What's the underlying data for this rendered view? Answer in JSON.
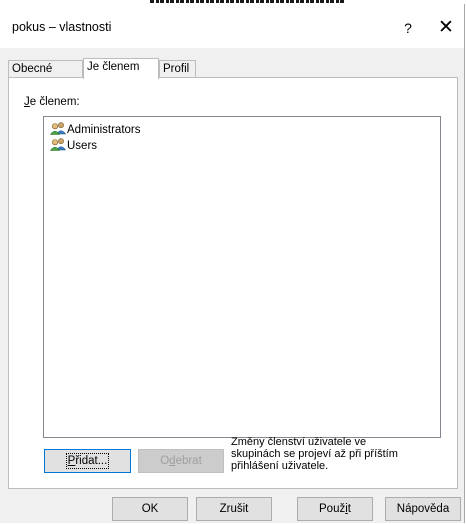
{
  "window": {
    "title": "pokus – vlastnosti",
    "help_glyph": "?",
    "close_glyph": "✕"
  },
  "tabs": [
    {
      "label": "Obecné",
      "active": false
    },
    {
      "label": "Je členem",
      "active": true
    },
    {
      "label": "Profil",
      "active": false
    }
  ],
  "member_of": {
    "label_mnemonic": "J",
    "label_rest": "e členem:",
    "items": [
      {
        "label": "Administrators",
        "icon": "group-icon"
      },
      {
        "label": "Users",
        "icon": "group-icon"
      }
    ]
  },
  "actions": {
    "add": {
      "mnemonic": "P",
      "rest": "řidat..."
    },
    "remove": {
      "before": "O",
      "mnemonic": "d",
      "rest": "ebrat",
      "enabled": false
    }
  },
  "note": {
    "lines": [
      "Změny členství uživatele ve",
      "skupinách se projeví až při příštím",
      "přihlášení uživatele."
    ]
  },
  "footer": {
    "ok": "OK",
    "cancel": "Zrušit",
    "apply_before": "Použ",
    "apply_mnemonic": "i",
    "apply_rest": "t",
    "help": "Nápověda"
  },
  "colors": {
    "focus": "#0078d7",
    "panel": "#ffffff",
    "dialog": "#f0f0f0"
  }
}
